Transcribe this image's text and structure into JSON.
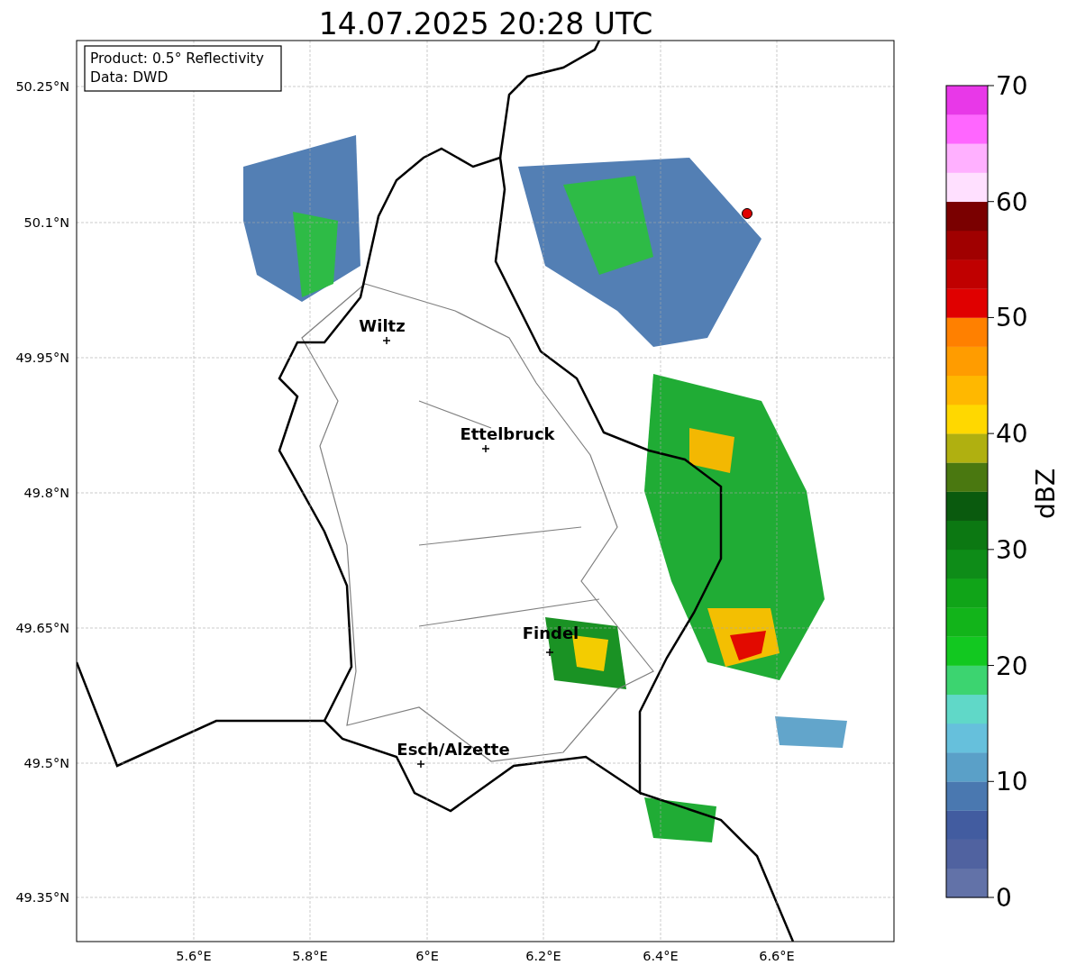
{
  "title": "14.07.2025 20:28 UTC",
  "info_box": [
    "Product: 0.5° Reflectivity",
    "Data: DWD"
  ],
  "cities": [
    {
      "name": "Wiltz"
    },
    {
      "name": "Ettelbruck"
    },
    {
      "name": "Findel"
    },
    {
      "name": "Esch/Alzette"
    }
  ],
  "y_ticks": [
    "50.25°N",
    "50.1°N",
    "49.95°N",
    "49.8°N",
    "49.65°N",
    "49.5°N",
    "49.35°N"
  ],
  "x_ticks": [
    "5.6°E",
    "5.8°E",
    "6°E",
    "6.2°E",
    "6.4°E",
    "6.6°E"
  ],
  "colorbar": {
    "label": "dBZ",
    "ticks": [
      "70",
      "60",
      "50",
      "40",
      "30",
      "20",
      "10",
      "0"
    ],
    "bins": [
      {
        "color": "#6272a8"
      },
      {
        "color": "#5062a0"
      },
      {
        "color": "#425ca0"
      },
      {
        "color": "#4a78b0"
      },
      {
        "color": "#5aa0c8"
      },
      {
        "color": "#66c0dc"
      },
      {
        "color": "#60d8c8"
      },
      {
        "color": "#3cd470"
      },
      {
        "color": "#12c820"
      },
      {
        "color": "#12b41a"
      },
      {
        "color": "#10a418"
      },
      {
        "color": "#0e8c18"
      },
      {
        "color": "#0c7812"
      },
      {
        "color": "#0a5a0e"
      },
      {
        "color": "#4a7810"
      },
      {
        "color": "#b0b010"
      },
      {
        "color": "#ffd800"
      },
      {
        "color": "#ffb800"
      },
      {
        "color": "#ff9c00"
      },
      {
        "color": "#ff8000"
      },
      {
        "color": "#e00000"
      },
      {
        "color": "#c00000"
      },
      {
        "color": "#a00000"
      },
      {
        "color": "#7a0000"
      },
      {
        "color": "#ffe0ff"
      },
      {
        "color": "#ffb0ff"
      },
      {
        "color": "#ff66ff"
      },
      {
        "color": "#e838e8"
      }
    ]
  }
}
